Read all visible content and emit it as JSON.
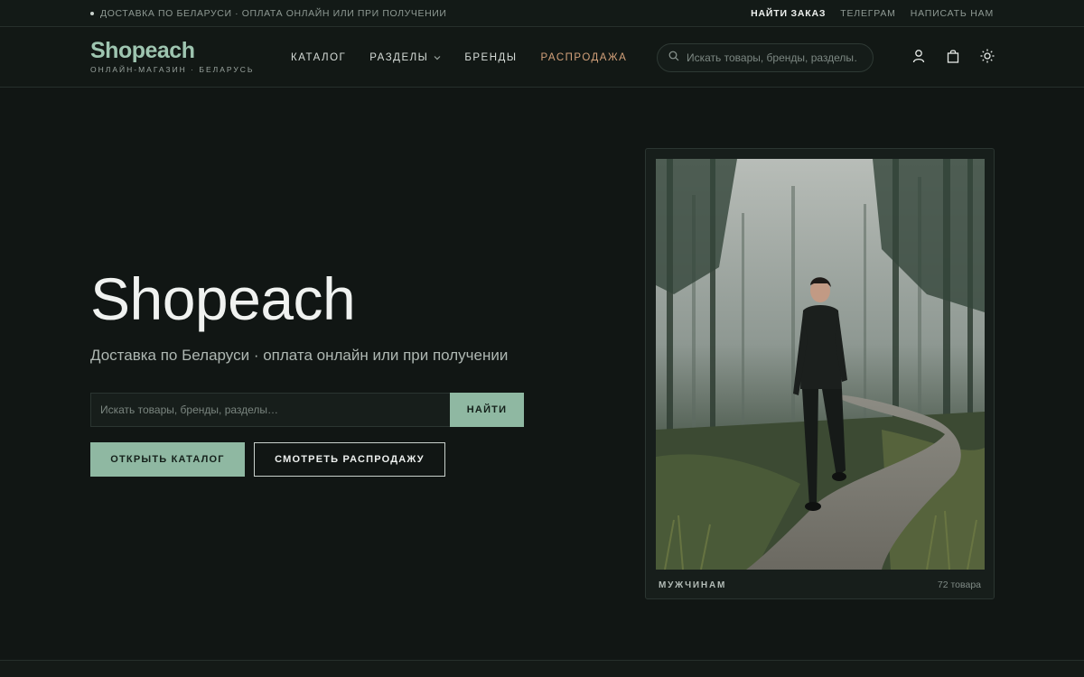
{
  "topbar": {
    "notice": "ДОСТАВКА ПО БЕЛАРУСИ · ОПЛАТА ОНЛАЙН ИЛИ ПРИ ПОЛУЧЕНИИ",
    "links": [
      "НАЙТИ ЗАКАЗ",
      "ТЕЛЕГРАМ",
      "НАПИСАТЬ НАМ"
    ]
  },
  "header": {
    "logo": "Shopeach",
    "logo_sub": "ОНЛАЙН-МАГАЗИН · БЕЛАРУСЬ",
    "nav": [
      "КАТАЛОГ",
      "РАЗДЕЛЫ",
      "БРЕНДЫ",
      "РАСПРОДАЖА"
    ],
    "search_placeholder": "Искать товары, бренды, разделы…",
    "icons": [
      "user-icon",
      "bag-icon",
      "sun-icon"
    ]
  },
  "hero": {
    "title": "Shopeach",
    "subtitle": "Доставка по Беларуси · оплата онлайн или при получении",
    "search_placeholder": "Искать товары, бренды, разделы…",
    "search_button": "НАЙТИ",
    "primary_button": "ОТКРЫТЬ КАТАЛОГ",
    "secondary_button": "СМОТРЕТЬ РАСПРОДАЖУ"
  },
  "card": {
    "label": "МУЖЧИНАМ",
    "count": "72 товара"
  },
  "colors": {
    "accent": "#8fb8a2",
    "sale": "#d3a17a",
    "background": "#111614"
  }
}
